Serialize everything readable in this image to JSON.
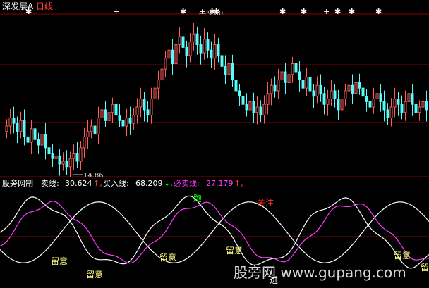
{
  "chart_data": [
    {
      "type": "candlestick",
      "title": "深发展A",
      "period": "日线",
      "annotations": {
        "high": "9.00",
        "low": "14.86"
      },
      "colors": {
        "up": "#ff5c5c",
        "down": "#54fcfc",
        "title": "#ffffff",
        "period": "#ff3c3c",
        "grid": "#8b0000"
      },
      "close": [
        16.6,
        16.9,
        16.7,
        16.4,
        16.8,
        16.2,
        16.0,
        16.5,
        16.1,
        15.9,
        16.3,
        15.8,
        15.6,
        15.4,
        15.5,
        15.2,
        15.3,
        15.1,
        15.4,
        15.6,
        15.3,
        15.8,
        16.2,
        16.4,
        16.6,
        16.3,
        16.9,
        17.2,
        16.8,
        17.1,
        17.4,
        17.0,
        16.8,
        16.6,
        16.9,
        16.7,
        17.0,
        17.3,
        17.6,
        17.2,
        17.0,
        17.6,
        18.0,
        18.3,
        18.7,
        19.1,
        19.4,
        18.9,
        19.6,
        19.9,
        19.5,
        19.2,
        19.7,
        20.0,
        19.6,
        19.3,
        19.8,
        19.4,
        19.1,
        19.6,
        19.2,
        18.8,
        18.5,
        18.9,
        18.3,
        17.9,
        17.7,
        17.4,
        17.2,
        17.5,
        17.1,
        17.3,
        17.0,
        17.4,
        17.8,
        18.1,
        17.9,
        18.3,
        18.6,
        18.2,
        18.5,
        18.9,
        18.6,
        18.3,
        18.0,
        18.4,
        17.9,
        17.7,
        18.1,
        17.8,
        17.4,
        17.6,
        17.9,
        17.6,
        17.2,
        17.6,
        17.9,
        18.1,
        17.8,
        18.2,
        18.0,
        17.7,
        17.5,
        17.3,
        17.6,
        17.8,
        17.5,
        17.2,
        16.9,
        17.3,
        17.6,
        17.4,
        17.1,
        17.5,
        17.8,
        17.4,
        17.1,
        17.3,
        17.5,
        17.2
      ]
    },
    {
      "type": "line",
      "title": "股旁网制",
      "legend": [
        {
          "label": "卖线:",
          "value": "30.624",
          "arrow": "↑,",
          "color": "#ffffff"
        },
        {
          "label": "买入线:",
          "value": "68.209",
          "arrow": "↓,",
          "color": "#ffffff"
        },
        {
          "label": "必卖线:",
          "value": "27.179",
          "arrow": "↑,",
          "color": "#ff3cff"
        }
      ],
      "annotations": [
        {
          "text": "留意",
          "color": "#ffff80"
        },
        {
          "text": "留意",
          "color": "#ffff80"
        },
        {
          "text": "留意",
          "color": "#ffff80"
        },
        {
          "text": "留意",
          "color": "#ffff80"
        },
        {
          "text": "留意",
          "color": "#ffff80"
        },
        {
          "text": "留意",
          "color": "#ffff80"
        },
        {
          "text": "跑",
          "color": "#00ff00"
        },
        {
          "text": "关注",
          "color": "#ff3030"
        },
        {
          "text": "进",
          "color": "#ffffff"
        }
      ],
      "watermark": "股旁网 www.gupang.com"
    }
  ]
}
